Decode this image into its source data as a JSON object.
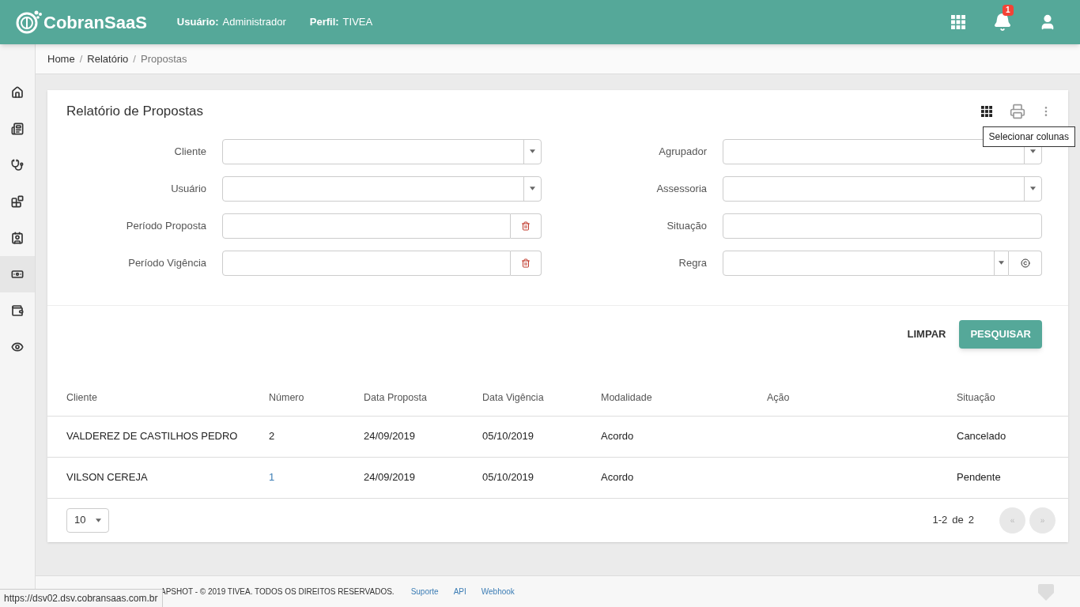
{
  "header": {
    "brand": "CobranSaaS",
    "user_label": "Usuário:",
    "user_value": "Administrador",
    "profile_label": "Perfil:",
    "profile_value": "TIVEA",
    "notification_count": "1"
  },
  "sidebar": {
    "items": [
      {
        "selected": false
      },
      {
        "selected": false
      },
      {
        "selected": false
      },
      {
        "selected": false
      },
      {
        "selected": false
      },
      {
        "selected": true
      },
      {
        "selected": false
      },
      {
        "selected": false
      }
    ]
  },
  "breadcrumb": {
    "separator": "/",
    "items": [
      "Home",
      "Relatório",
      "Propostas"
    ]
  },
  "card": {
    "title": "Relatório de Propostas",
    "tooltip": "Selecionar colunas",
    "filters_left": [
      {
        "label": "Cliente",
        "kind": "select"
      },
      {
        "label": "Usuário",
        "kind": "select"
      },
      {
        "label": "Período Proposta",
        "kind": "date"
      },
      {
        "label": "Período Vigência",
        "kind": "date"
      }
    ],
    "filters_right": [
      {
        "label": "Agrupador",
        "kind": "select"
      },
      {
        "label": "Assessoria",
        "kind": "select"
      },
      {
        "label": "Situação",
        "kind": "text"
      },
      {
        "label": "Regra",
        "kind": "select_button"
      }
    ],
    "clear_button": "LIMPAR",
    "search_button": "PESQUISAR"
  },
  "table": {
    "columns": [
      "Cliente",
      "Número",
      "Data Proposta",
      "Data Vigência",
      "Modalidade",
      "Ação",
      "Situação"
    ],
    "rows": [
      {
        "cells": [
          "VALDEREZ DE CASTILHOS PEDRO",
          "2",
          "24/09/2019",
          "05/10/2019",
          "Acordo",
          "",
          "Cancelado"
        ],
        "number_link": false
      },
      {
        "cells": [
          "VILSON CEREJA",
          "1",
          "24/09/2019",
          "05/10/2019",
          "Acordo",
          "",
          "Pendente"
        ],
        "number_link": true
      }
    ]
  },
  "pagination": {
    "page_size": "10",
    "range": "1-2",
    "of": "de",
    "total": "2",
    "prev": "«",
    "next": "»",
    "prev_disabled": true,
    "next_disabled": true
  },
  "footer": {
    "copyright": "APSHOT - © 2019 TIVEA. TODOS OS DIREITOS RESERVADOS.",
    "links": [
      "Suporte",
      "API",
      "Webhook"
    ]
  },
  "status_url": "https://dsv02.dsv.cobransaas.com.br"
}
